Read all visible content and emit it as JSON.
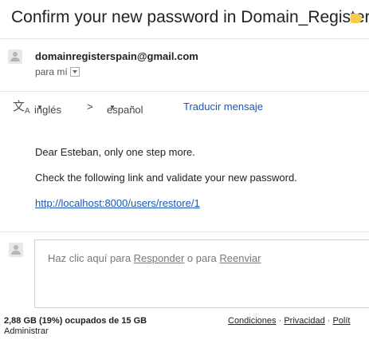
{
  "email": {
    "subject": "Confirm your new password in Domain_Register",
    "sender": "domainregisterspain@gmail.com",
    "to": "para mí"
  },
  "translate": {
    "from_lang": "inglés",
    "arrow": ">",
    "to_lang": "español",
    "action": "Traducir mensaje"
  },
  "body": {
    "greeting": "Dear Esteban, only one step more.",
    "instruction": "Check the following link and validate your new password.",
    "link": "http://localhost:8000/users/restore/1"
  },
  "reply": {
    "prefix": "Haz clic aquí para ",
    "reply_link": "Responder",
    "middle": " o para ",
    "forward_link": "Reenviar"
  },
  "footer": {
    "storage": "2,88 GB (19%) ocupados de 15 GB",
    "manage": "Administrar",
    "terms": "Condiciones",
    "dot1": " · ",
    "privacy": "Privacidad",
    "dot2": " · ",
    "policy": "Polít"
  },
  "colors": {
    "label_tag": "#f7cb4d",
    "link": "#1a57b8"
  }
}
